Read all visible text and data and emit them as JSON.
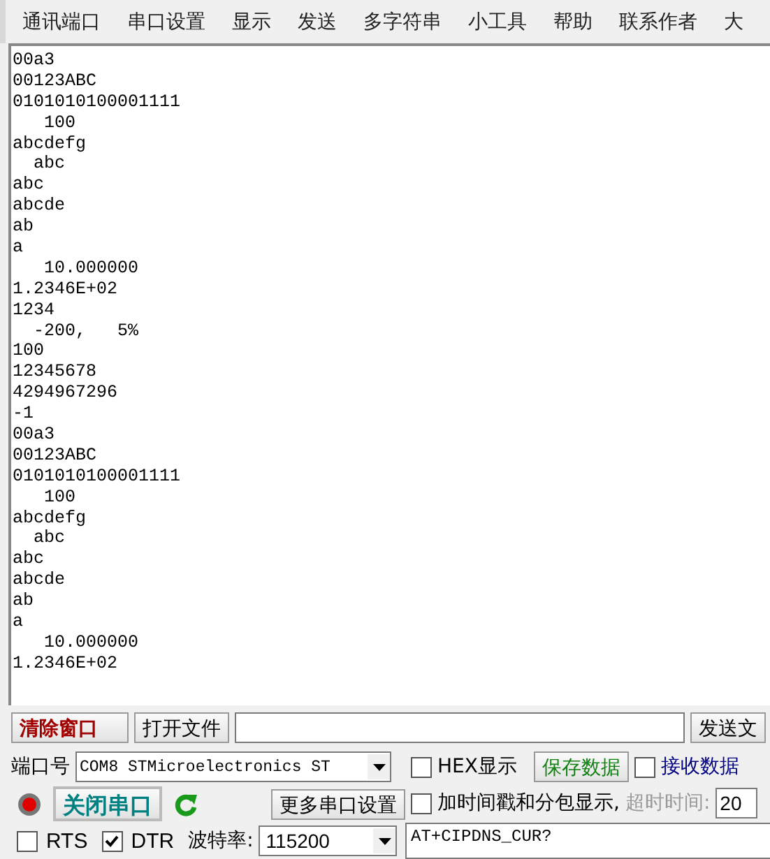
{
  "menu": [
    "通讯端口",
    "串口设置",
    "显示",
    "发送",
    "多字符串",
    "小工具",
    "帮助",
    "联系作者",
    "大"
  ],
  "log_lines": [
    "00a3",
    "00123ABC",
    "0101010100001111",
    "   100",
    "abcdefg",
    "  abc",
    "abc",
    "abcde",
    "ab",
    "a",
    "   10.000000",
    "1.2346E+02",
    "1234",
    "  -200,   5%",
    "100",
    "12345678",
    "4294967296",
    "-1",
    "00a3",
    "00123ABC",
    "0101010100001111",
    "   100",
    "abcdefg",
    "  abc",
    "abc",
    "abcde",
    "ab",
    "a",
    "   10.000000",
    "1.2346E+02"
  ],
  "file_row": {
    "clear_button": "清除窗口",
    "open_button": "打开文件",
    "send_file_button": "发送文"
  },
  "port": {
    "label": "端口号",
    "value": "COM8 STMicroelectronics ST",
    "open": true,
    "toggle_button": "关闭串口",
    "more_button": "更多串口设置"
  },
  "lines": [
    {
      "kind": "check",
      "label": "RTS",
      "checked": false
    },
    {
      "kind": "check",
      "label": "DTR",
      "checked": true
    }
  ],
  "baud": {
    "label": "波特率:",
    "value": "115200"
  },
  "options": {
    "hex": {
      "label": "HEX显示",
      "checked": false
    },
    "save_button": "保存数据",
    "receive": {
      "label": "接收数据",
      "checked": false
    },
    "timestamp": {
      "label": "加时间戳和分包显示,",
      "checked": false
    },
    "timeout_label": "超时时间:",
    "timeout_value": "20"
  },
  "send_text": "AT+CIPDNS_CUR?"
}
